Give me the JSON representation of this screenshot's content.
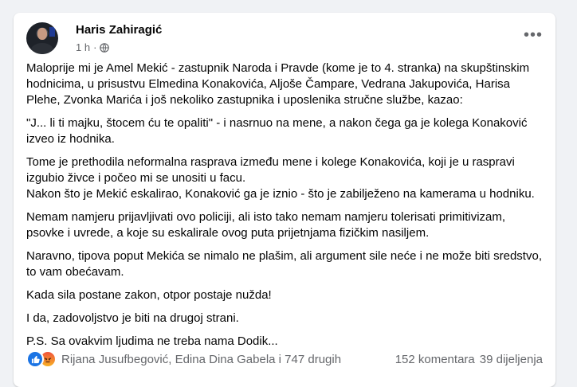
{
  "post": {
    "author": "Haris Zahiragić",
    "time": "1 h",
    "more_label": "•••",
    "paragraphs": [
      {
        "lines": [
          "Maloprije mi je Amel Mekić  - zastupnik Naroda i Pravde (kome je to 4. stranka) na skupštinskim hodnicima, u prisustvu Elmedina Konakovića, Aljoše Čampare, Vedrana Jakupovića, Harisa Plehe, Zvonka Marića i još nekoliko zastupnika i uposlenika stručne službe, kazao:"
        ]
      },
      {
        "lines": [
          "\"J... li ti majku, štocem ću te opaliti\" - i nasrnuo na mene, a nakon čega ga je kolega Konaković izveo iz hodnika."
        ]
      },
      {
        "lines": [
          "Tome je prethodila neformalna rasprava između mene i kolege Konakovića, koji je u raspravi izgubio živce i počeo mi se unositi u facu.",
          "Nakon što je Mekić eskalirao, Konaković ga je iznio - što je zabilježeno na kamerama u hodniku."
        ]
      },
      {
        "lines": [
          "Nemam namjeru prijavljivati ovo policiji, ali isto tako nemam namjeru tolerisati primitivizam, psovke i uvrede, a koje su eskalirale ovog puta prijetnjama fizičkim nasiljem."
        ]
      },
      {
        "lines": [
          "Naravno, tipova poput Mekića se nimalo ne plašim, ali argument sile neće i ne može biti sredstvo, to vam obećavam."
        ]
      },
      {
        "lines": [
          "Kada sila postane zakon, otpor postaje nužda!"
        ]
      },
      {
        "lines": [
          "I da, zadovoljstvo je biti na drugoj strani."
        ]
      },
      {
        "lines": [
          "P.S. Sa ovakvim ljudima ne treba nama Dodik..."
        ]
      }
    ]
  },
  "footer": {
    "reactions": [
      "like-icon",
      "angry-icon"
    ],
    "reaction_names": "Rijana Jusufbegović, Edina Dina Gabela i 747 drugih",
    "comments": "152 komentara",
    "shares": "39 dijeljenja"
  },
  "colors": {
    "background": "#f0f2f5",
    "card": "#ffffff",
    "text": "#050505",
    "secondary_text": "#65676b",
    "like_blue": "#1b74e4"
  }
}
